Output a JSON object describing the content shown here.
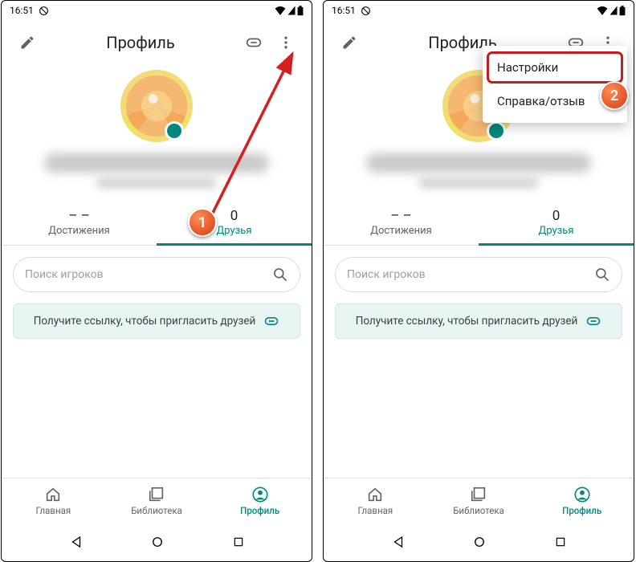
{
  "status": {
    "time": "16:51"
  },
  "appbar": {
    "title": "Профиль"
  },
  "tabs": {
    "achievements": {
      "count": "– –",
      "label": "Достижения"
    },
    "friends": {
      "count": "0",
      "label": "Друзья"
    }
  },
  "search": {
    "placeholder": "Поиск игроков"
  },
  "invite": {
    "text": "Получите ссылку, чтобы пригласить друзей"
  },
  "bottomnav": {
    "home": "Главная",
    "library": "Библиотека",
    "profile": "Профиль"
  },
  "menu": {
    "settings": "Настройки",
    "help": "Справка/отзыв"
  },
  "callouts": {
    "one": "1",
    "two": "2"
  }
}
